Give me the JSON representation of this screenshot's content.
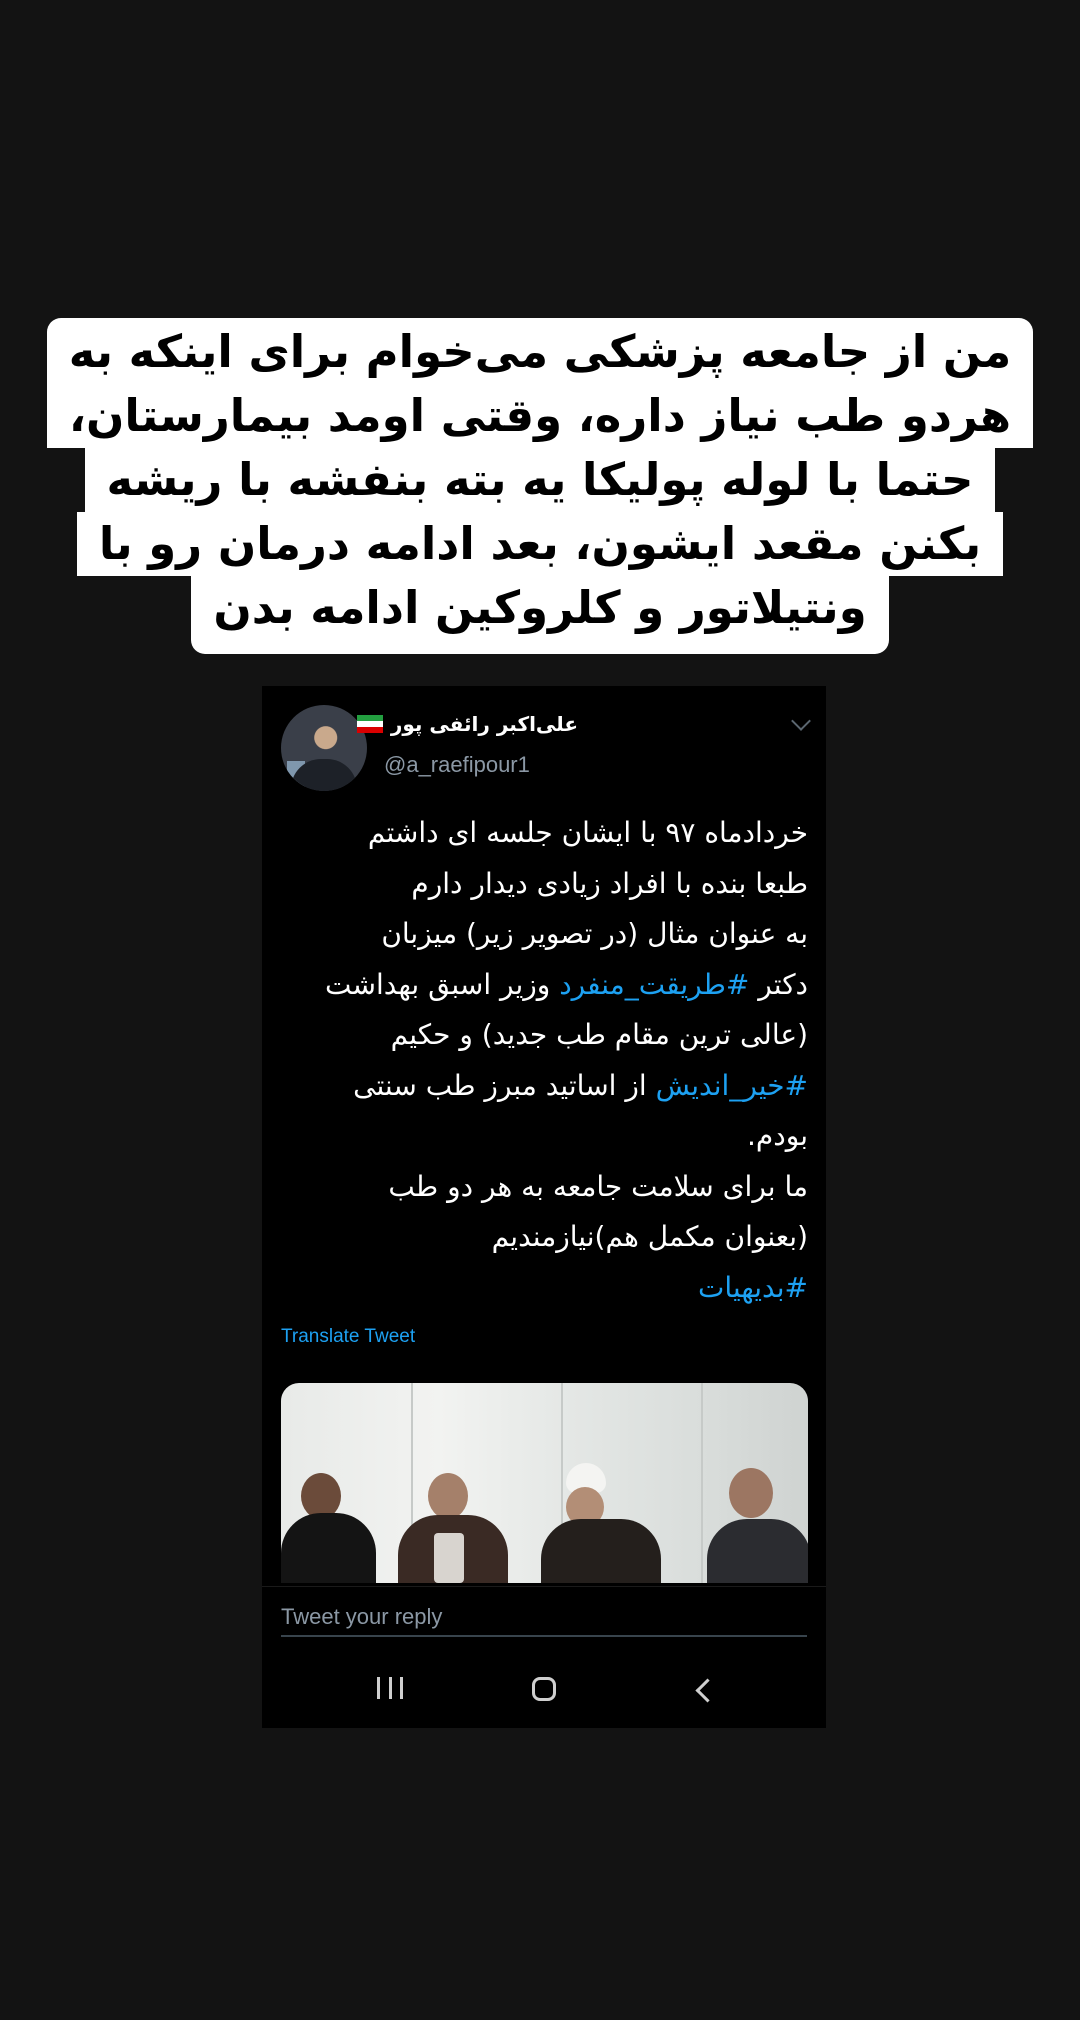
{
  "caption": {
    "lines": [
      "من از جامعه پزشکی می‌خوام برای اینکه به",
      "هردو طب نیاز داره، وقتی اومد بیمارستان،",
      "حتما با لوله پولیکا یه بته بنفشه با ریشه",
      "بکنن مقعد ایشون، بعد ادامه درمان رو با",
      "ونتیلاتور و کلروکین ادامه بدن"
    ]
  },
  "tweet": {
    "author_name": "علی‌اکبر رائفی پور",
    "author_flag": "iran-flag",
    "author_handle": "@a_raefipour1",
    "body": {
      "line1": "خردادماه ۹۷ با ایشان جلسه ای داشتم",
      "line2": "طبعا بنده با افراد زیادی دیدار دارم",
      "line3": "به عنوان مثال (در تصویر زیر) میزبان",
      "line4_pre": "دکتر ",
      "line4_tag": "#طریقت_منفرد",
      "line4_post": " وزیر اسبق بهداشت",
      "line5": "(عالی ترین مقام طب جدید) و حکیم",
      "line6_tag": "#خیر_اندیش",
      "line6_post": " از اساتید مبرز طب سنتی",
      "line7": "بودم.",
      "line8": "ما برای سلامت جامعه به هر دو طب",
      "line9": "(بعنوان مکمل هم)نیازمندیم",
      "line10_tag": "#بدیهیات"
    },
    "translate_label": "Translate Tweet",
    "photo_label": "photo-four-men-meeting"
  },
  "reply": {
    "placeholder": "Tweet your reply"
  },
  "nav": {
    "icons": [
      "recents-icon",
      "home-icon",
      "back-icon"
    ]
  },
  "colors": {
    "background": "#131313",
    "link": "#1da1f2",
    "muted": "#8b98a5"
  }
}
